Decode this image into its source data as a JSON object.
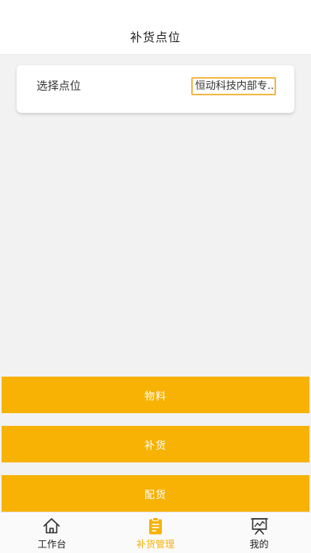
{
  "header": {
    "title": "补货点位"
  },
  "card": {
    "label": "选择点位",
    "select_value": "恒动科技内部专..."
  },
  "actions": {
    "materials": "物料",
    "restock": "补货",
    "distribute": "配货"
  },
  "tabbar": {
    "tabs": [
      {
        "label": "工作台",
        "icon": "home-icon",
        "active": false
      },
      {
        "label": "补货管理",
        "icon": "clipboard-icon",
        "active": true
      },
      {
        "label": "我的",
        "icon": "chart-board-icon",
        "active": false
      }
    ]
  },
  "colors": {
    "accent": "#f7b203",
    "select_border": "#f0b94a",
    "background": "#f2f2f2"
  }
}
